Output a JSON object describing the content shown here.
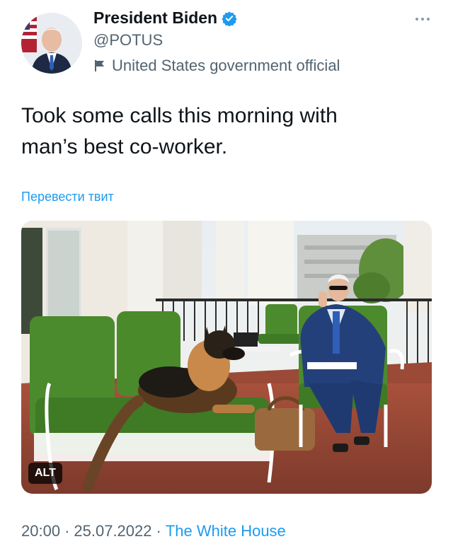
{
  "author": {
    "name": "President Biden",
    "handle": "@POTUS",
    "label": "United States government official"
  },
  "tweet": {
    "text_line1": "Took some calls this morning with",
    "text_line2": "man’s best co-worker.",
    "translate_label": "Перевести твит",
    "alt_label": "ALT"
  },
  "meta": {
    "time": "20:00",
    "date": "25.07.2022",
    "separator": "·",
    "source": "The White House"
  },
  "icons": {
    "verified": "verified-badge-icon",
    "government": "flag-icon",
    "more": "more-options-icon"
  },
  "colors": {
    "accent": "#1d9bf0",
    "secondary_text": "#536471",
    "cushion_green": "#4c8a2e"
  }
}
